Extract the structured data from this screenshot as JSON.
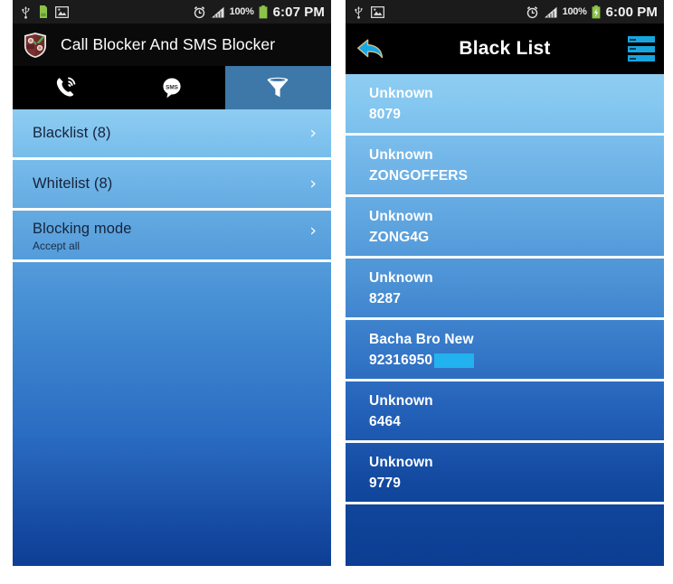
{
  "left_phone": {
    "status_bar": {
      "icons": [
        "usb-icon",
        "sdcard-icon",
        "picture-icon"
      ],
      "alarm_icon": "alarm-clock-icon",
      "signal_icon": "signal-bars-icon",
      "battery_percent": "100%",
      "battery_icon": "battery-full-icon",
      "time": "6:07 PM"
    },
    "app_bar": {
      "icon": "shield-app-icon",
      "title": "Call Blocker And SMS Blocker"
    },
    "tabs": [
      {
        "name": "tab-calls",
        "icon": "phone-call-icon",
        "selected": false
      },
      {
        "name": "tab-sms",
        "icon": "sms-bubble-icon",
        "selected": false,
        "glyph": "SMS"
      },
      {
        "name": "tab-filter",
        "icon": "funnel-filter-icon",
        "selected": true
      }
    ],
    "rows": [
      {
        "title": "Blacklist (8)",
        "subtitle": "",
        "chevron": "›"
      },
      {
        "title": "Whitelist (8)",
        "subtitle": "",
        "chevron": "›"
      },
      {
        "title": "Blocking mode",
        "subtitle": "Accept all",
        "chevron": "›"
      }
    ]
  },
  "right_phone": {
    "status_bar": {
      "icons": [
        "usb-icon",
        "picture-icon"
      ],
      "alarm_icon": "alarm-clock-icon",
      "signal_icon": "signal-bars-icon",
      "battery_percent": "100%",
      "battery_icon": "battery-charging-icon",
      "time": "6:00 PM"
    },
    "title_bar": {
      "back_icon": "back-arrow-icon",
      "title": "Black List",
      "menu_icon": "list-menu-icon"
    },
    "entries": [
      {
        "name": "Unknown",
        "number": "8079",
        "redacted": false
      },
      {
        "name": "Unknown",
        "number": "ZONGOFFERS",
        "redacted": false
      },
      {
        "name": "Unknown",
        "number": "ZONG4G",
        "redacted": false
      },
      {
        "name": "Unknown",
        "number": "8287",
        "redacted": false
      },
      {
        "name": "Bacha Bro New",
        "number": "92316950",
        "redacted": true
      },
      {
        "name": "Unknown",
        "number": "6464",
        "redacted": false
      },
      {
        "name": "Unknown",
        "number": "9779",
        "redacted": false
      }
    ]
  },
  "colors": {
    "accent_cyan": "#17a5e0",
    "redaction": "#22b2f0",
    "tab_selected": "#3d78a8",
    "gradient_top": "#8ecdf2",
    "gradient_bottom": "#0b3e93",
    "status_bar_bg": "#1b1b1b",
    "battery_green": "#8bc34a"
  }
}
